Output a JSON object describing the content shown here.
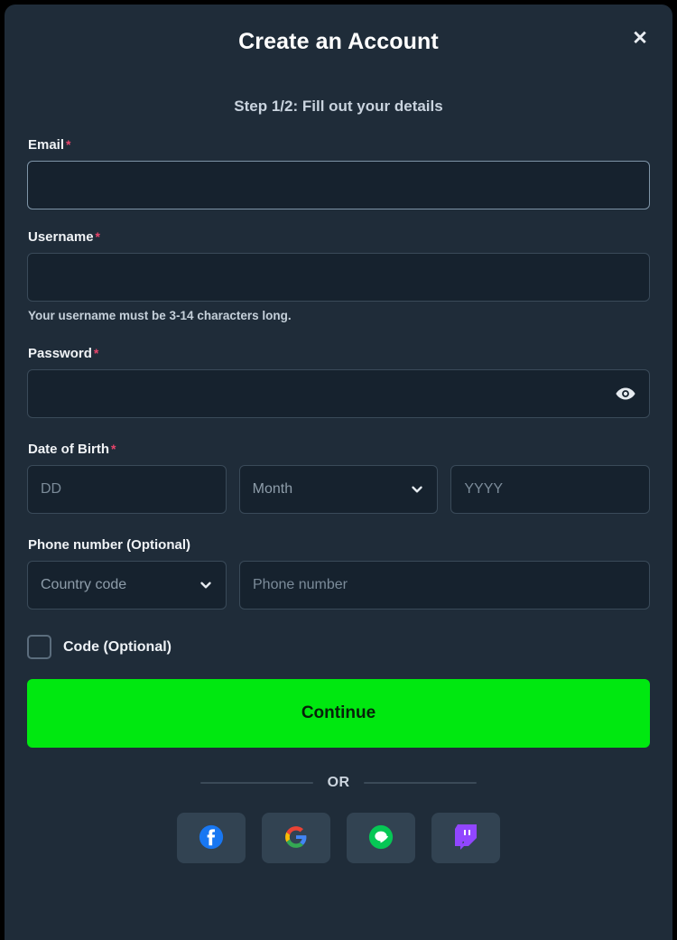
{
  "modal": {
    "title": "Create an Account",
    "close_icon": "close-icon",
    "step_text": "Step 1/2: Fill out your details"
  },
  "form": {
    "required_marker": "*",
    "email": {
      "label": "Email",
      "required": true,
      "value": "",
      "placeholder": ""
    },
    "username": {
      "label": "Username",
      "required": true,
      "value": "",
      "placeholder": "",
      "helper": "Your username must be 3-14 characters long."
    },
    "password": {
      "label": "Password",
      "required": true,
      "value": "",
      "placeholder": "",
      "toggle_icon": "eye-icon"
    },
    "date_of_birth": {
      "label": "Date of Birth",
      "required": true,
      "day_placeholder": "DD",
      "day_value": "",
      "month_selected": "Month",
      "month_chevron_icon": "chevron-down-icon",
      "year_placeholder": "YYYY",
      "year_value": ""
    },
    "phone": {
      "label": "Phone number (Optional)",
      "country_code_selected": "Country code",
      "country_chevron_icon": "chevron-down-icon",
      "number_placeholder": "Phone number",
      "number_value": ""
    },
    "code_checkbox": {
      "label": "Code (Optional)",
      "checked": false
    }
  },
  "actions": {
    "continue_label": "Continue",
    "divider_label": "OR",
    "social": [
      {
        "name": "facebook",
        "icon": "facebook-icon"
      },
      {
        "name": "google",
        "icon": "google-icon"
      },
      {
        "name": "line",
        "icon": "line-icon"
      },
      {
        "name": "twitch",
        "icon": "twitch-icon"
      }
    ]
  },
  "colors": {
    "panel_bg": "#1f2c39",
    "input_bg": "#16222e",
    "input_border": "#3a4a59",
    "input_border_focus": "#7e94a7",
    "accent_green": "#00e810",
    "required_red": "#e8456b",
    "social_bg": "#324352"
  }
}
